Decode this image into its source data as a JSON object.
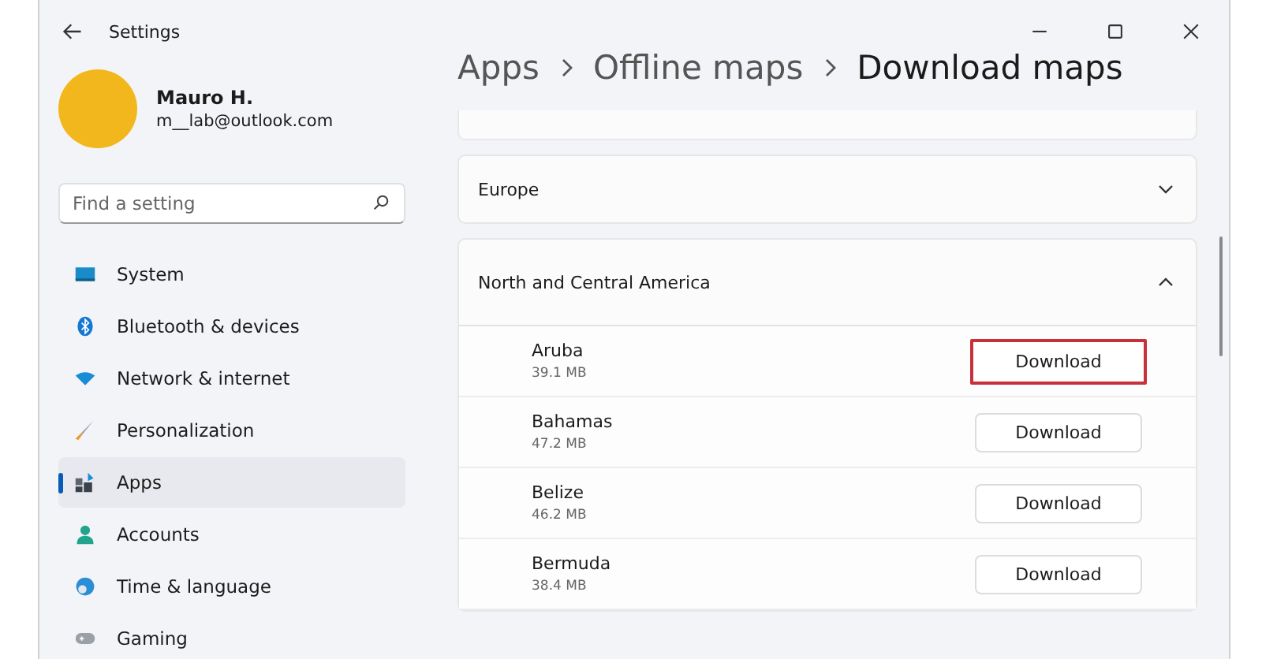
{
  "window": {
    "title": "Settings"
  },
  "profile": {
    "name": "Mauro H.",
    "email": "m__lab@outlook.com"
  },
  "search": {
    "placeholder": "Find a setting"
  },
  "sidebar": {
    "items": [
      {
        "label": "System",
        "selected": false
      },
      {
        "label": "Bluetooth & devices",
        "selected": false
      },
      {
        "label": "Network & internet",
        "selected": false
      },
      {
        "label": "Personalization",
        "selected": false
      },
      {
        "label": "Apps",
        "selected": true
      },
      {
        "label": "Accounts",
        "selected": false
      },
      {
        "label": "Time & language",
        "selected": false
      },
      {
        "label": "Gaming",
        "selected": false
      }
    ]
  },
  "breadcrumb": [
    "Apps",
    "Offline maps",
    "Download maps"
  ],
  "regions": [
    {
      "label": "Europe",
      "expanded": false
    },
    {
      "label": "North and Central America",
      "expanded": true,
      "maps": [
        {
          "name": "Aruba",
          "size": "39.1 MB",
          "button": "Download",
          "highlighted": true
        },
        {
          "name": "Bahamas",
          "size": "47.2 MB",
          "button": "Download",
          "highlighted": false
        },
        {
          "name": "Belize",
          "size": "46.2 MB",
          "button": "Download",
          "highlighted": false
        },
        {
          "name": "Bermuda",
          "size": "38.4 MB",
          "button": "Download",
          "highlighted": false
        }
      ]
    }
  ]
}
